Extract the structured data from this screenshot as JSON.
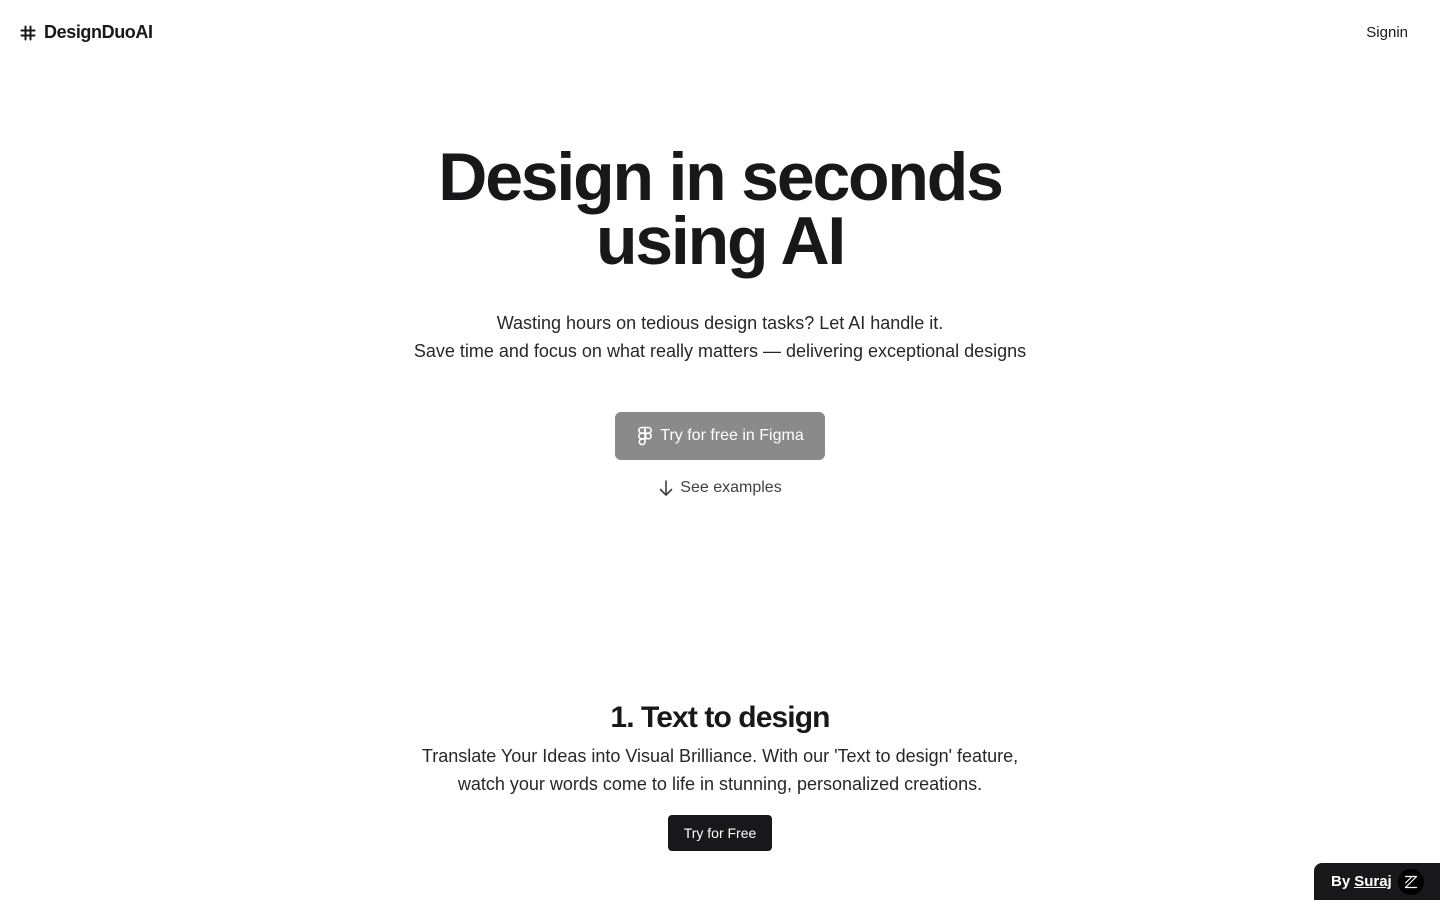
{
  "nav": {
    "brand_icon": "hash-icon",
    "brand_name": "DesignDuoAI",
    "signin_label": "Signin"
  },
  "hero": {
    "title_line1": "Design in seconds",
    "title_line2": "using AI",
    "sub_line1": "Wasting hours on tedious design tasks? Let AI handle it.",
    "sub_line2": "Save time and focus on what really matters — delivering exceptional designs",
    "cta_icon": "figma-icon",
    "cta_label": "Try for free in Figma",
    "examples_icon": "arrow-down-icon",
    "examples_label": "See examples"
  },
  "feature": {
    "title": "1. Text to design",
    "desc_line1": "Translate Your Ideas into Visual Brilliance. With our 'Text to design' feature,",
    "desc_line2": "watch your words come to life in stunning, personalized creations.",
    "button_label": "Try for Free"
  },
  "badge": {
    "by_text": "By",
    "author": "Suraj",
    "logo_icon": "z-logo-icon"
  },
  "colors": {
    "text": "#18181b",
    "primary_button": "#18181b",
    "figma_button": "#8a8a8a",
    "background": "#ffffff"
  }
}
